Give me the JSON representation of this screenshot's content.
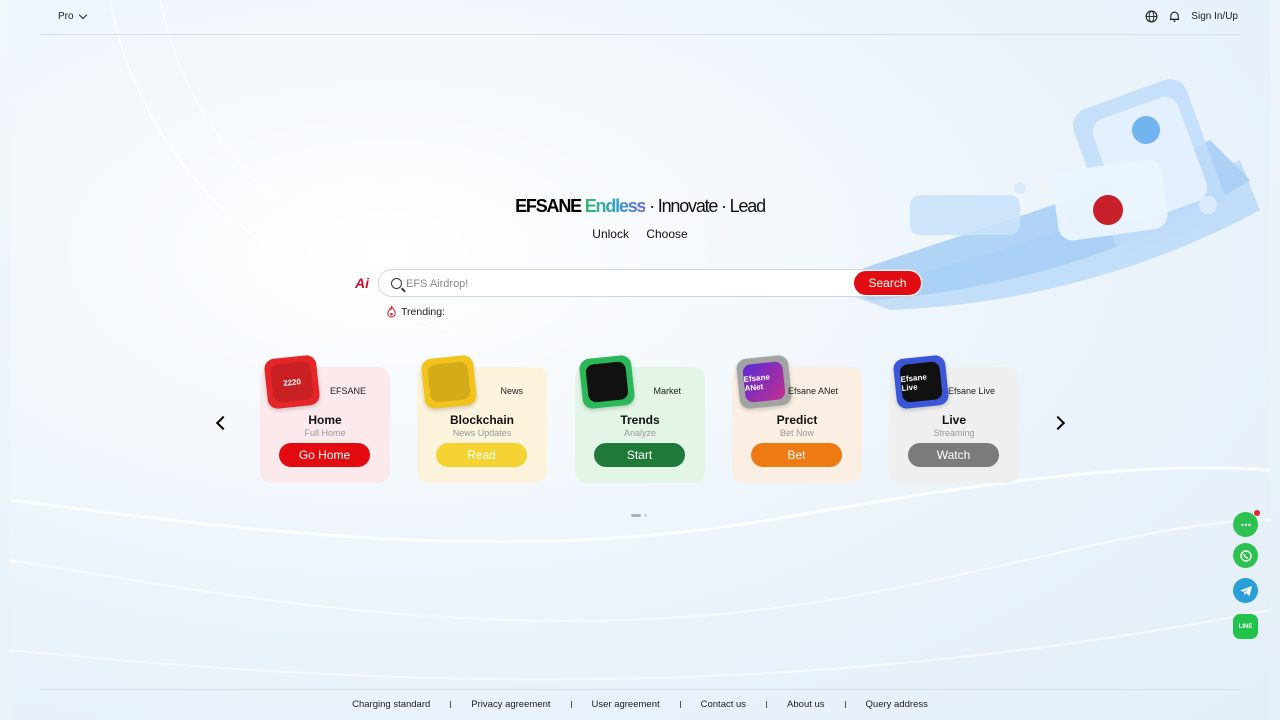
{
  "header": {
    "product_selector": "Pro",
    "sign_in_label": "Sign In/Up",
    "icons": [
      "globe-icon",
      "bell-icon"
    ]
  },
  "hero": {
    "brand": "EFSANE",
    "highlight": "Endless",
    "tagline_rest": "· Innovate · Lead",
    "sub_left": "Unlock",
    "sub_right": "Choose"
  },
  "search": {
    "logo": "Ai",
    "placeholder": "EFS Airdrop!",
    "button_label": "Search"
  },
  "trending": {
    "label": "Trending:"
  },
  "cards": [
    {
      "category": "EFSANE",
      "title": "Home",
      "subtitle": "Full Home",
      "button": "Go Home",
      "tile_text": "2220",
      "icon": "efsane-logo-icon",
      "bg": "#fbe9ec",
      "button_color": "#e30b10",
      "tile_color": "#e52528"
    },
    {
      "category": "News",
      "title": "Blockchain",
      "subtitle": "News Updates",
      "button": "Read",
      "tile_text": "",
      "icon": "news-building-icon",
      "bg": "#fbf3dc",
      "button_color": "#f4d332",
      "tile_color": "#f2c31d"
    },
    {
      "category": "Market",
      "title": "Trends",
      "subtitle": "Analyze",
      "button": "Start",
      "tile_text": "",
      "icon": "market-chart-icon",
      "bg": "#e3f5e6",
      "button_color": "#1f7a3a",
      "tile_color": "#2bb85a"
    },
    {
      "category": "Efsane ANet",
      "title": "Predict",
      "subtitle": "Bet Now",
      "button": "Bet",
      "tile_text": "Efsane ANet",
      "icon": "predict-logo-icon",
      "bg": "#fbefe4",
      "button_color": "#ee7a14",
      "tile_color": "#a3a3a3"
    },
    {
      "category": "Efsane Live",
      "title": "Live",
      "subtitle": "Streaming",
      "button": "Watch",
      "tile_text": "Efsane Live",
      "icon": "live-logo-icon",
      "bg": "#efefef",
      "button_color": "#7b7b7b",
      "tile_color": "#3b57d8"
    }
  ],
  "carousel": {
    "prev_icon": "chevron-left-icon",
    "next_icon": "chevron-right-icon"
  },
  "social": [
    {
      "name": "chat-icon",
      "color": "#2dc24f"
    },
    {
      "name": "whatsapp-icon",
      "color": "#2dc24f"
    },
    {
      "name": "telegram-icon",
      "color": "#2a9ed8"
    },
    {
      "name": "line-icon",
      "color": "#21c24a",
      "label": "LINE"
    }
  ],
  "footer": {
    "links": [
      "Charging standard",
      "Privacy agreement",
      "User agreement",
      "Contact us",
      "About us",
      "Query address"
    ]
  },
  "colors": {
    "accent_red": "#e10d12",
    "background": "#eaf2f9"
  }
}
